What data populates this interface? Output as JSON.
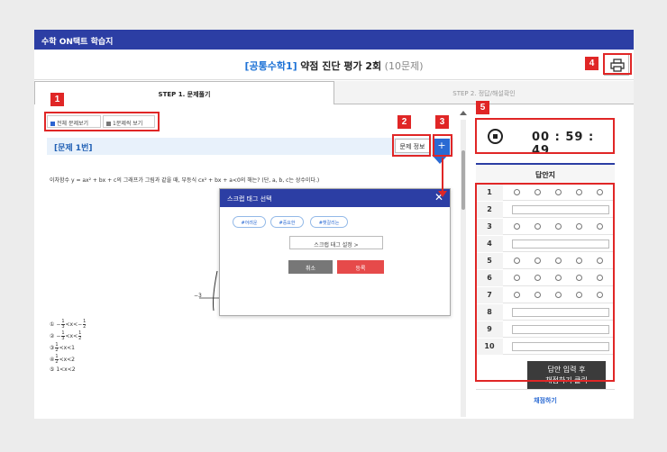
{
  "app": {
    "title": "수학 ON택트 학습지"
  },
  "header": {
    "course": "[공통수학1]",
    "test_name": "약점 진단 평가 2회",
    "count": "(10문제)"
  },
  "tabs": [
    {
      "label": "STEP 1. 문제풀기",
      "active": true
    },
    {
      "label": "STEP 2. 정답/해설확인",
      "active": false
    }
  ],
  "view": {
    "all_label": "전체 문제보기",
    "one_label": "1문제씩 보기"
  },
  "question": {
    "title": "[문제 1번]",
    "info_button": "문제 정보",
    "scrap_button": "+",
    "text": "이차함수 y = ax² + bx + c의 그래프가 그림과 같을 때, 부등식 cx² + bx + a<0의 해는? (단, a, b, c는 상수이다.)",
    "graph_label": "−3",
    "choices": [
      {
        "marker": "①",
        "left": "−",
        "n1": "1",
        "d1": "3",
        "mid": "<x<−",
        "n2": "1",
        "d2": "2",
        "tail": ""
      },
      {
        "marker": "②",
        "left": "−",
        "n1": "1",
        "d1": "3",
        "mid": "<x<",
        "n2": "1",
        "d2": "2",
        "tail": ""
      },
      {
        "marker": "③",
        "left": "",
        "n1": "1",
        "d1": "2",
        "mid": "<x<1",
        "n2": "",
        "d2": "",
        "tail": ""
      },
      {
        "marker": "④",
        "left": "",
        "n1": "1",
        "d1": "2",
        "mid": "<x<2",
        "n2": "",
        "d2": "",
        "tail": ""
      },
      {
        "marker": "⑤",
        "left": "",
        "n1": "",
        "d1": "",
        "mid": "1<x<2",
        "n2": "",
        "d2": "",
        "tail": ""
      }
    ]
  },
  "modal": {
    "title": "스크랩 태그 선택",
    "close": "✕",
    "tags": [
      "#어려운",
      "#중요한",
      "#헷갈리는"
    ],
    "setting_button": "스크랩 태그 설정 >",
    "cancel": "취소",
    "register": "등록"
  },
  "timer": {
    "value": "00 : 59 : 49"
  },
  "answer_sheet": {
    "title": "답안지",
    "rows": [
      {
        "num": "1",
        "type": "choice"
      },
      {
        "num": "2",
        "type": "input"
      },
      {
        "num": "3",
        "type": "choice"
      },
      {
        "num": "4",
        "type": "input"
      },
      {
        "num": "5",
        "type": "choice"
      },
      {
        "num": "6",
        "type": "choice"
      },
      {
        "num": "7",
        "type": "choice"
      },
      {
        "num": "8",
        "type": "input"
      },
      {
        "num": "9",
        "type": "input"
      },
      {
        "num": "10",
        "type": "input"
      }
    ],
    "tooltip_line1": "답안 입력 후",
    "tooltip_line2": "채점하기 클릭",
    "grade_button": "채점하기"
  },
  "annotations": {
    "badge1": "1",
    "badge2": "2",
    "badge3": "3",
    "badge4": "4",
    "badge5": "5"
  },
  "colors": {
    "brand": "#2c3ea4",
    "accent": "#2a6ad3",
    "annotation": "#e02626"
  }
}
